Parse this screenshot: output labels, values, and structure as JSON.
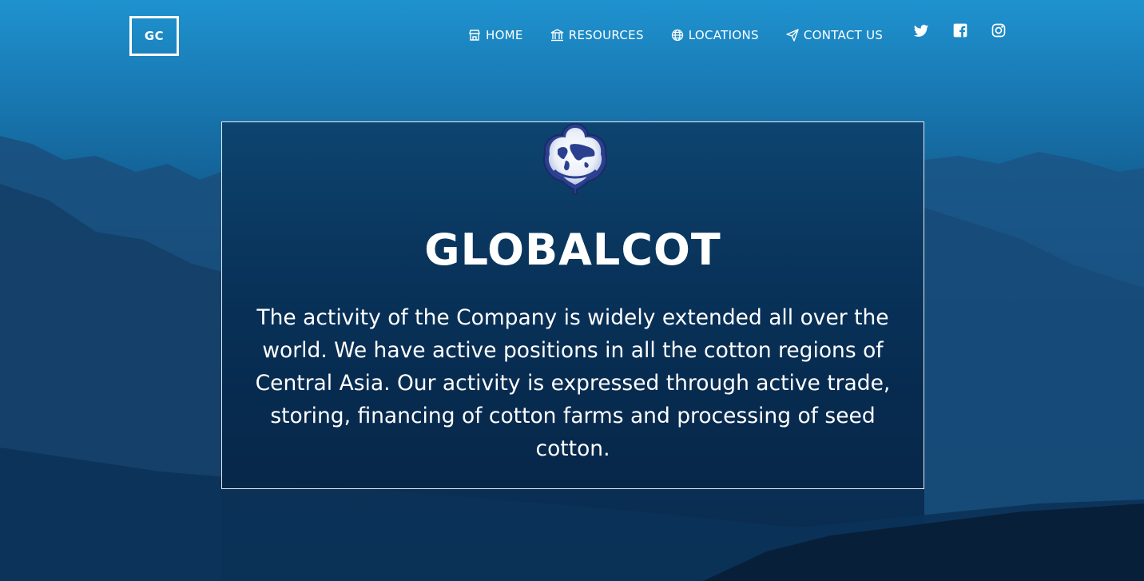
{
  "header": {
    "logo_text": "GC",
    "nav": [
      {
        "label": "HOME",
        "icon": "store-icon"
      },
      {
        "label": "RESOURCES",
        "icon": "bank-icon"
      },
      {
        "label": "LOCATIONS",
        "icon": "globe-icon"
      },
      {
        "label": "CONTACT US",
        "icon": "send-icon"
      }
    ],
    "social": [
      "twitter-icon",
      "facebook-icon",
      "instagram-icon"
    ]
  },
  "hero": {
    "title": "GLOBALCOT",
    "description": "The activity of the Company is widely extended all over the world. We have active positions in all the cotton regions of Central Asia. Our activity is expressed through active trade, storing, financing of cotton farms and processing of seed cotton."
  },
  "colors": {
    "sky_top": "#1f93cf",
    "bottom": "#08284a",
    "panel_bg": "#062042",
    "emblem_blue": "#2b3f8f"
  }
}
